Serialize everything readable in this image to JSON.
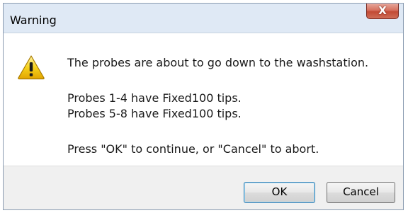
{
  "window": {
    "title": "Warning",
    "close_label": "X"
  },
  "message": {
    "line1": "The probes are about to go down to the washstation.",
    "line2": "Probes 1-4 have Fixed100 tips.",
    "line3": "Probes 5-8 have Fixed100 tips.",
    "line4": "Press \"OK\" to continue, or \"Cancel\" to abort."
  },
  "buttons": {
    "ok_label": "OK",
    "cancel_label": "Cancel"
  },
  "icons": {
    "warning": "warning-icon",
    "close": "close-icon"
  },
  "colors": {
    "close_button": "#c94a33",
    "warning_yellow": "#f6d21c",
    "ok_focus_border": "#3c7fb1"
  }
}
